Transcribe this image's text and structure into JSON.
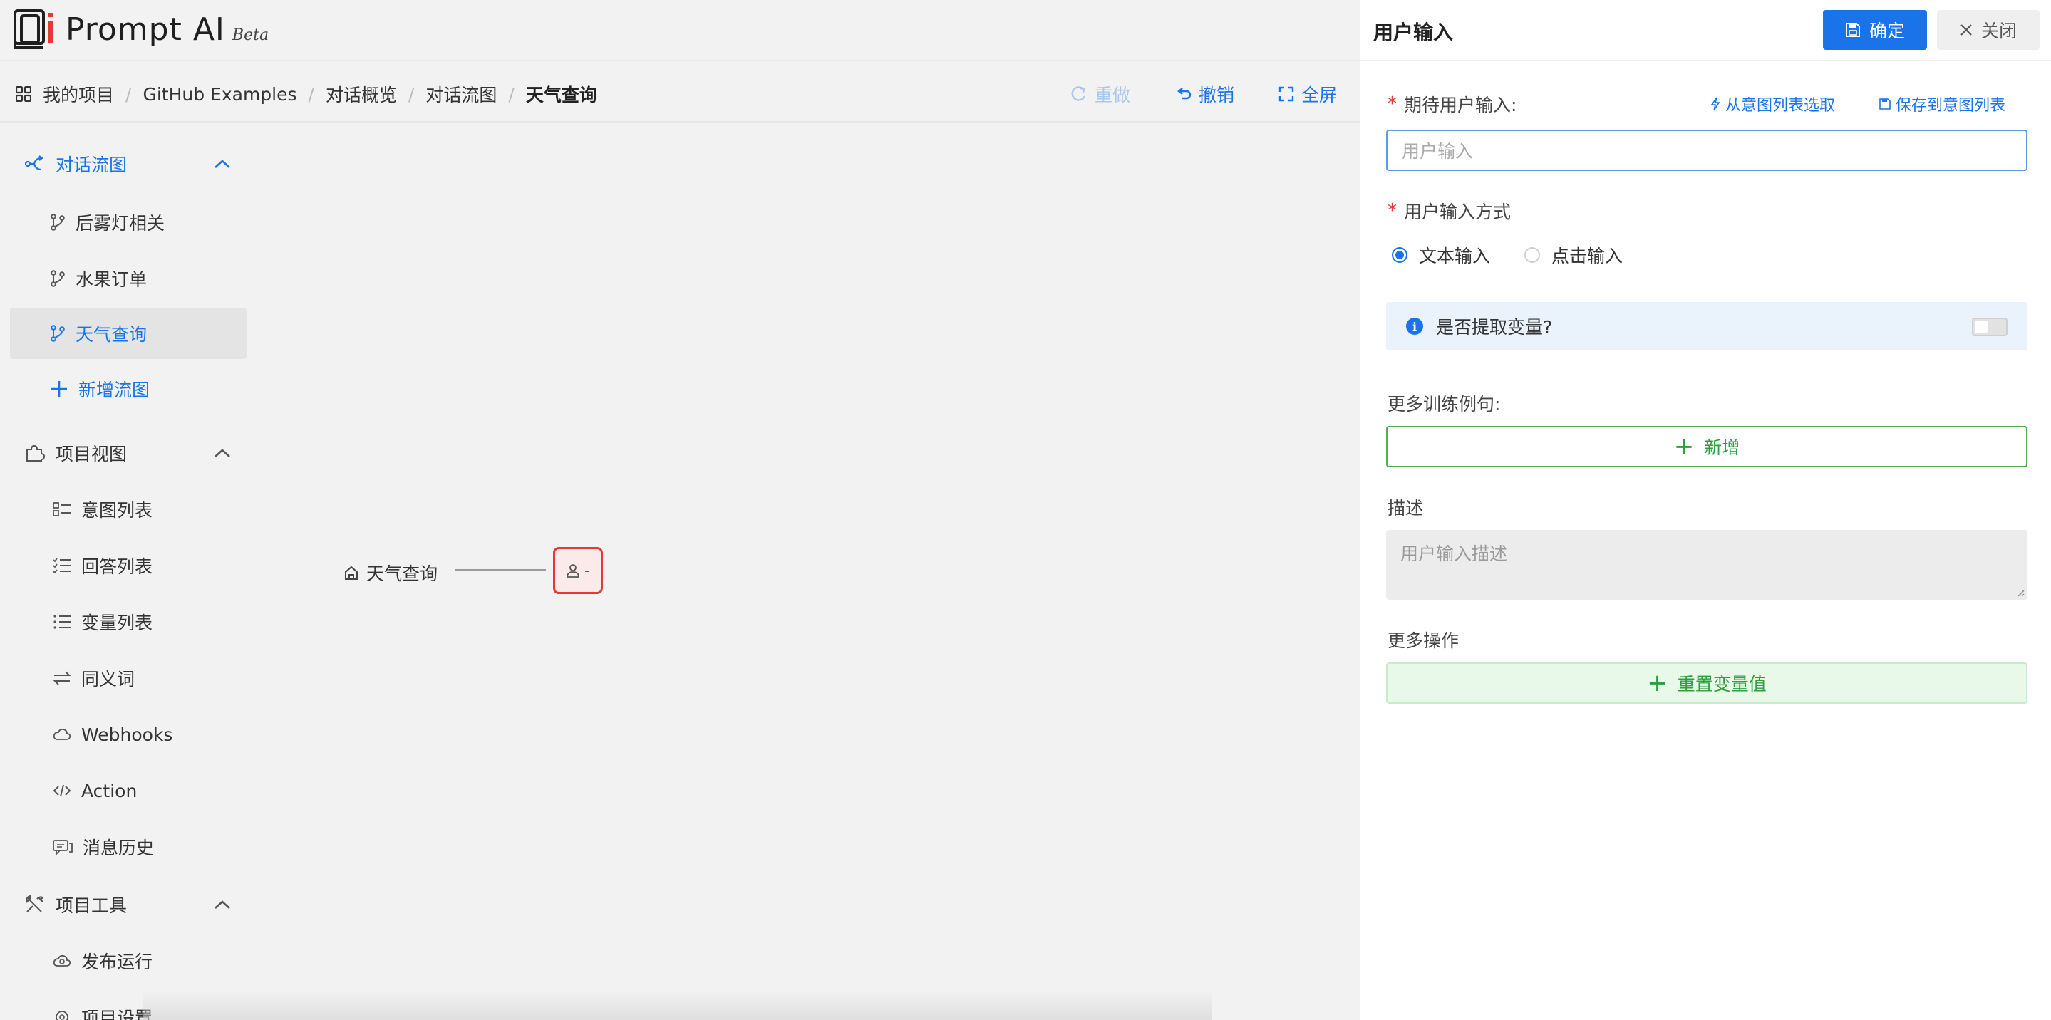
{
  "app": {
    "name": "Prompt AI",
    "badge": "Beta"
  },
  "breadcrumb": {
    "items": [
      "我的项目",
      "GitHub Examples",
      "对话概览",
      "对话流图"
    ],
    "current": "天气查询",
    "separator": "/"
  },
  "toolbar": {
    "redo": "重做",
    "undo": "撤销",
    "fullscreen": "全屏"
  },
  "sidebar": {
    "flow_group": "对话流图",
    "flows": [
      "后雾灯相关",
      "水果订单",
      "天气查询"
    ],
    "add_flow": "新增流图",
    "project_view_group": "项目视图",
    "views": [
      "意图列表",
      "回答列表",
      "变量列表",
      "同义词",
      "Webhooks",
      "Action",
      "消息历史"
    ],
    "tools_group": "项目工具",
    "tools": [
      "发布运行",
      "项目设置"
    ]
  },
  "canvas": {
    "root_node": "天气查询",
    "user_node": "-"
  },
  "panel": {
    "title": "用户输入",
    "confirm": "确定",
    "close": "关闭",
    "expected_input_label": "期待用户输入:",
    "pick_from_intents": "从意图列表选取",
    "save_to_intents": "保存到意图列表",
    "input_placeholder": "用户输入",
    "input_mode_label": "用户输入方式",
    "mode_text": "文本输入",
    "mode_click": "点击输入",
    "extract_variable": "是否提取变量?",
    "more_examples_label": "更多训练例句:",
    "add": "新增",
    "description_label": "描述",
    "description_placeholder": "用户输入描述",
    "more_actions_label": "更多操作",
    "reset_variables": "重置变量值"
  },
  "colors": {
    "accent": "#1a73e8",
    "danger": "#e53935",
    "success": "#2e9e3e"
  }
}
